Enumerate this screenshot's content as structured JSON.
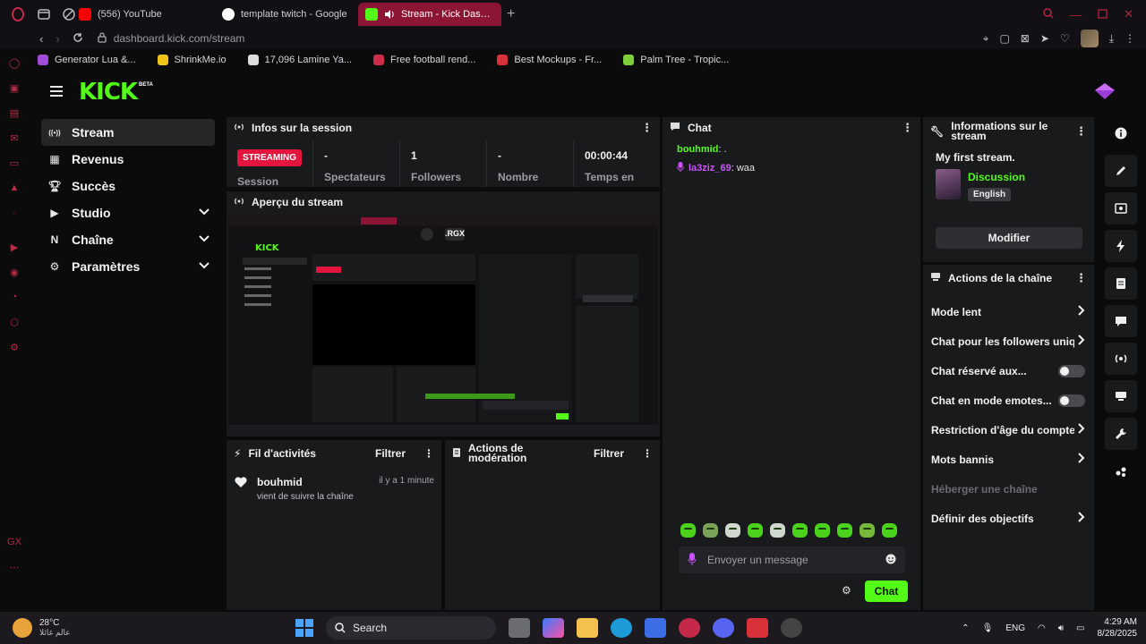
{
  "browser": {
    "tabs": [
      {
        "label": "(556) YouTube",
        "color": "#ff0000",
        "active": false
      },
      {
        "label": "template twitch - Google",
        "color": "#4285f4",
        "active": false
      },
      {
        "label": "Stream - Kick Dashbo",
        "color": "#53fc18",
        "active": true
      }
    ],
    "url_domain": "dashboard.kick.com",
    "url_path": "/stream",
    "bookmarks": [
      {
        "label": "Generator Lua &...",
        "color": "#a24bd8"
      },
      {
        "label": "ShrinkMe.io",
        "color": "#f0c419"
      },
      {
        "label": "17,096 Lamine Ya...",
        "color": "#dddddd"
      },
      {
        "label": "Free football rend...",
        "color": "#cc2d4a"
      },
      {
        "label": "Best Mockups - Fr...",
        "color": "#d8313a"
      },
      {
        "label": "Palm Tree - Tropic...",
        "color": "#7fcf3a"
      }
    ],
    "opera_side_icons": [
      "opera-icon",
      "notes-icon",
      "wallet-icon",
      "mail-icon",
      "bookmark-icon",
      "arrow-icon",
      "separator",
      "twitch-icon",
      "player-icon",
      "history-icon",
      "extensions-icon",
      "settings-icon",
      "gx-icon",
      "more-icon"
    ]
  },
  "kick": {
    "logo": "KICK",
    "beta": "BETA",
    "accent": "#53fc18",
    "nav": [
      {
        "label": "Stream",
        "icon": "broadcast-icon",
        "active": true,
        "expandable": false
      },
      {
        "label": "Revenus",
        "icon": "chart-icon",
        "active": false,
        "expandable": false
      },
      {
        "label": "Succès",
        "icon": "trophy-icon",
        "active": false,
        "expandable": false
      },
      {
        "label": "Studio",
        "icon": "studio-icon",
        "active": false,
        "expandable": true
      },
      {
        "label": "Chaîne",
        "icon": "channel-icon",
        "active": false,
        "expandable": true
      },
      {
        "label": "Paramètres",
        "icon": "gear-icon",
        "active": false,
        "expandable": true
      }
    ],
    "session": {
      "title": "Infos sur la session",
      "status": "STREAMING",
      "status_sub": "Session",
      "cells": [
        {
          "value": "-",
          "label": "Spectateurs"
        },
        {
          "value": "1",
          "label": "Followers"
        },
        {
          "value": "-",
          "label": "Nombre"
        },
        {
          "value": "00:00:44",
          "label": "Temps en"
        }
      ]
    },
    "preview": {
      "title": "Aperçu du stream",
      "overlay_tag": ".RGX"
    },
    "activity": {
      "title": "Fil d'activités",
      "filter": "Filtrer",
      "items": [
        {
          "name": "bouhmid",
          "desc": "vient de suivre la chaîne",
          "time": "il y a 1 minute"
        }
      ]
    },
    "moderation": {
      "title_line1": "Actions de",
      "title_line2": "modération",
      "filter": "Filtrer"
    },
    "chat": {
      "title": "Chat",
      "messages": [
        {
          "user": "bouhmid",
          "text": ".",
          "badge": false
        },
        {
          "user": "la3ziz_69",
          "text": "waa",
          "badge": true
        }
      ],
      "input_placeholder": "Envoyer un message",
      "send_label": "Chat"
    },
    "info": {
      "title": "Informations sur le stream",
      "stream_title": "My first stream.",
      "category": "Discussion",
      "language": "English",
      "modify_label": "Modifier"
    },
    "actions": {
      "title": "Actions de la chaîne",
      "items": [
        {
          "label": "Mode lent",
          "kind": "chevron",
          "disabled": false
        },
        {
          "label": "Chat pour les followers uniq",
          "kind": "chevron",
          "disabled": false
        },
        {
          "label": "Chat réservé aux...",
          "kind": "toggle",
          "disabled": false
        },
        {
          "label": "Chat en mode emotes...",
          "kind": "toggle",
          "disabled": false
        },
        {
          "label": "Restriction d'âge du compte",
          "kind": "chevron",
          "disabled": false
        },
        {
          "label": "Mots bannis",
          "kind": "chevron",
          "disabled": false
        },
        {
          "label": "Héberger une chaîne",
          "kind": "none",
          "disabled": true
        },
        {
          "label": "Définir des objectifs",
          "kind": "chevron",
          "disabled": false
        }
      ]
    }
  },
  "taskbar": {
    "temp": "28°C",
    "weather_sub": "عالم غائلا",
    "search": "Search",
    "lang": "ENG",
    "time": "4:29 AM",
    "date": "8/28/2025"
  }
}
